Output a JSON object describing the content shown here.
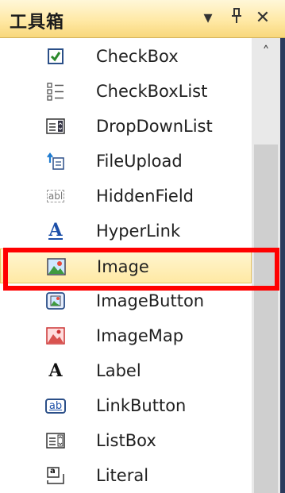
{
  "toolbox": {
    "title": "工具箱",
    "dropdown_glyph": "▾",
    "pin_glyph": "ᚨ",
    "close_glyph": "✕",
    "scroll_up_glyph": "˄",
    "items": [
      {
        "label": "CheckBox",
        "icon": "checkbox-icon"
      },
      {
        "label": "CheckBoxList",
        "icon": "checkbox-list-icon"
      },
      {
        "label": "DropDownList",
        "icon": "dropdown-list-icon"
      },
      {
        "label": "FileUpload",
        "icon": "file-upload-icon"
      },
      {
        "label": "HiddenField",
        "icon": "hidden-field-icon"
      },
      {
        "label": "HyperLink",
        "icon": "hyperlink-icon"
      },
      {
        "label": "Image",
        "icon": "image-icon"
      },
      {
        "label": "ImageButton",
        "icon": "image-button-icon"
      },
      {
        "label": "ImageMap",
        "icon": "image-map-icon"
      },
      {
        "label": "Label",
        "icon": "label-icon"
      },
      {
        "label": "LinkButton",
        "icon": "link-button-icon"
      },
      {
        "label": "ListBox",
        "icon": "list-box-icon"
      },
      {
        "label": "Literal",
        "icon": "literal-icon"
      }
    ],
    "selected_item": "Image",
    "icon_glyphs": {
      "abl": "abl",
      "hyperlink": "A",
      "label": "A",
      "ab": "ab",
      "a": "a"
    }
  }
}
